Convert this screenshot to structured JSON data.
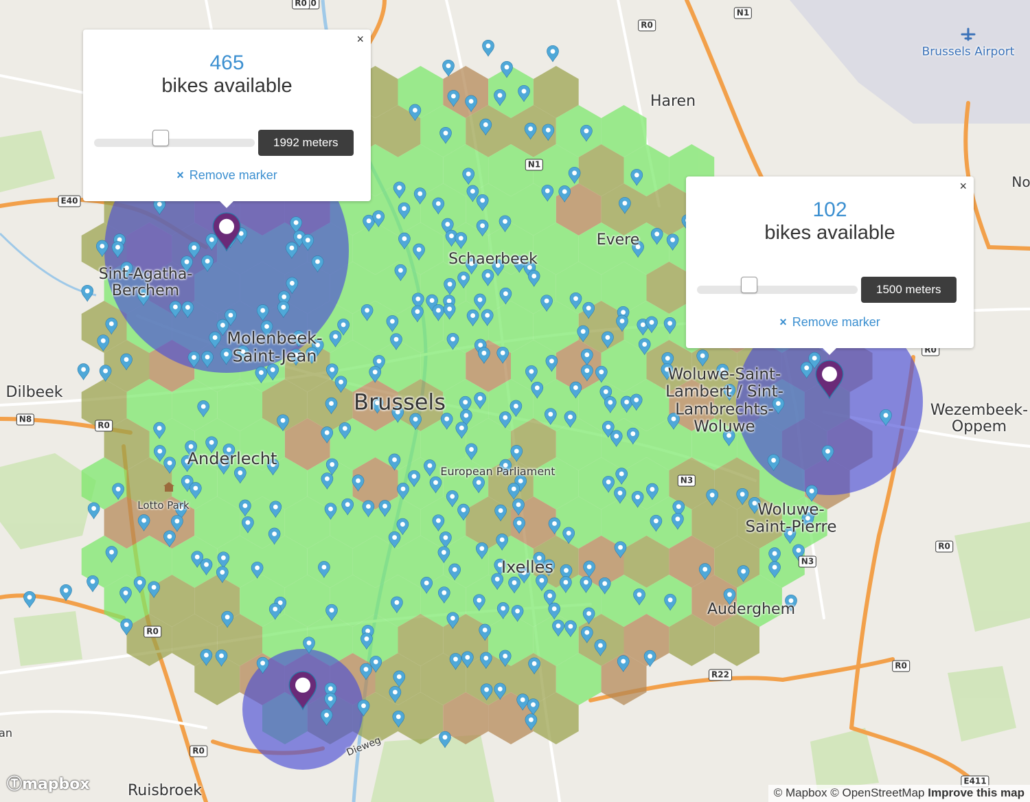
{
  "places": [
    {
      "name": "Haren",
      "size": 22
    },
    {
      "name": "Schaerbeek",
      "size": 22
    },
    {
      "name": "Evere",
      "size": 22
    },
    {
      "name": "Sint-Agatha-\nBerchem",
      "size": 22
    },
    {
      "name": "Molenbeek-\nSaint-Jean",
      "size": 24
    },
    {
      "name": "Brussels",
      "size": 32
    },
    {
      "name": "Dilbeek",
      "size": 22
    },
    {
      "name": "Anderlecht",
      "size": 24
    },
    {
      "name": "European Parliament",
      "size": 16
    },
    {
      "name": "Woluwe-Saint-\nLambert / Sint-\nLambrechts-\nWoluwe",
      "size": 23
    },
    {
      "name": "Wezembeek-\nOppem",
      "size": 22
    },
    {
      "name": "Woluwe-\nSaint-Pierre",
      "size": 23
    },
    {
      "name": "Ixelles",
      "size": 24
    },
    {
      "name": "Auderghem",
      "size": 22
    },
    {
      "name": "Lotto Park",
      "size": 15
    },
    {
      "name": "Ruisbroek",
      "size": 22
    },
    {
      "name": "Brussels Airport",
      "size": 17
    },
    {
      "name": "Dieweg",
      "size": 14
    },
    {
      "name": "No",
      "size": 20
    },
    {
      "name": "an",
      "size": 16
    }
  ],
  "road_labels": [
    "R0",
    "N1",
    "R0",
    "N1",
    "E40",
    "N8",
    "R0",
    "R0",
    "R0",
    "N3",
    "N3",
    "R0",
    "R0",
    "R0",
    "R22",
    "R0",
    "E411"
  ],
  "popups": [
    {
      "count": "465",
      "label": "bikes available",
      "distance": "1992 meters",
      "slider_value": 0.41,
      "remove_label": "Remove marker",
      "remove_icon": "×",
      "close": "×"
    },
    {
      "count": "102",
      "label": "bikes available",
      "distance": "1500 meters",
      "slider_value": 0.32,
      "remove_label": "Remove marker",
      "remove_icon": "×",
      "close": "×"
    }
  ],
  "colors": {
    "coverage_green": "#7be86a",
    "coverage_olive": "#9aa24c",
    "coverage_brown": "#b48855",
    "radius_fill": "#4b4fd6",
    "marker_purple": "#6a2a78",
    "station_pin": "#4fa8d8",
    "water": "#9fc9e8",
    "highway": "#f2a04a"
  },
  "icons": {
    "station": "map-pin-icon",
    "marker": "map-pin-icon",
    "airport": "airplane-icon",
    "landmark": "building-icon",
    "zoom": "mapbox-logo-icon"
  },
  "attribution": {
    "mapbox": "© Mapbox",
    "osm": "© OpenStreetMap",
    "improve": "Improve this map"
  },
  "logo": "mapbox"
}
